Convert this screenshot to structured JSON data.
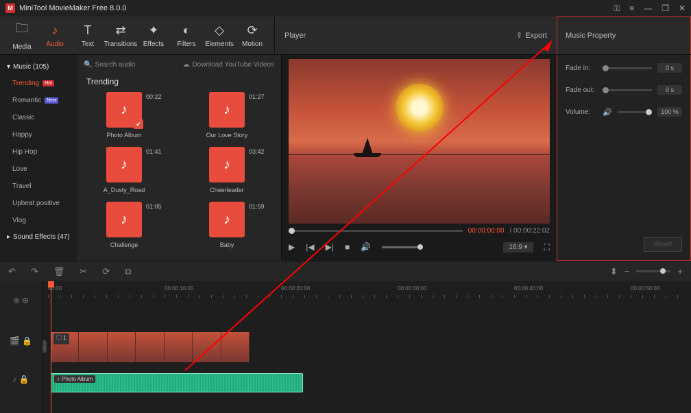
{
  "app": {
    "title": "MiniTool MovieMaker Free 8.0.0"
  },
  "toolbar": {
    "tabs": [
      {
        "key": "media",
        "label": "Media",
        "icon": "🗀"
      },
      {
        "key": "audio",
        "label": "Audio",
        "icon": "♪"
      },
      {
        "key": "text",
        "label": "Text",
        "icon": "T"
      },
      {
        "key": "transitions",
        "label": "Transitions",
        "icon": "⇄"
      },
      {
        "key": "effects",
        "label": "Effects",
        "icon": "✦"
      },
      {
        "key": "filters",
        "label": "Filters",
        "icon": "◐"
      },
      {
        "key": "elements",
        "label": "Elements",
        "icon": "◇"
      },
      {
        "key": "motion",
        "label": "Motion",
        "icon": "⟳"
      }
    ],
    "active": "audio"
  },
  "player_header": {
    "title": "Player",
    "export": "Export"
  },
  "prop_header": {
    "title": "Music Property"
  },
  "categories": {
    "music_header": "Music (105)",
    "items": [
      {
        "label": "Trending",
        "badge": "Hot",
        "badgeClass": "hot",
        "active": true
      },
      {
        "label": "Romantic",
        "badge": "New",
        "badgeClass": "new"
      },
      {
        "label": "Classic"
      },
      {
        "label": "Happy"
      },
      {
        "label": "Hip Hop"
      },
      {
        "label": "Love"
      },
      {
        "label": "Travel"
      },
      {
        "label": "Upbeat positive"
      },
      {
        "label": "Vlog"
      }
    ],
    "sfx_header": "Sound Effects (47)"
  },
  "grid": {
    "search": "Search audio",
    "download": "Download YouTube Videos",
    "section": "Trending",
    "cards": [
      {
        "name": "Photo Album",
        "dur": "00:22",
        "checked": true
      },
      {
        "name": "Our Love Story",
        "dur": "01:27"
      },
      {
        "name": "A_Dusty_Road",
        "dur": "01:41"
      },
      {
        "name": "Cheerleader",
        "dur": "03:42"
      },
      {
        "name": "Challenge",
        "dur": "01:05"
      },
      {
        "name": "Baby",
        "dur": "01:59"
      }
    ]
  },
  "playback": {
    "current": "00:00:00:00",
    "total": "00:00:22:02",
    "aspect": "16:9"
  },
  "properties": {
    "fade_in": {
      "label": "Fade in:",
      "value": "0 s"
    },
    "fade_out": {
      "label": "Fade out:",
      "value": "0 s"
    },
    "volume": {
      "label": "Volume:",
      "value": "100 %"
    },
    "reset": "Reset"
  },
  "timeline": {
    "marks": [
      "00:00",
      "00:00:10:00",
      "00:00:20:00",
      "00:00:30:00",
      "00:00:40:00",
      "00:00:50:00"
    ],
    "video_clip": {
      "label": "1",
      "count": 1
    },
    "audio_clip": {
      "label": "Photo Album"
    }
  }
}
